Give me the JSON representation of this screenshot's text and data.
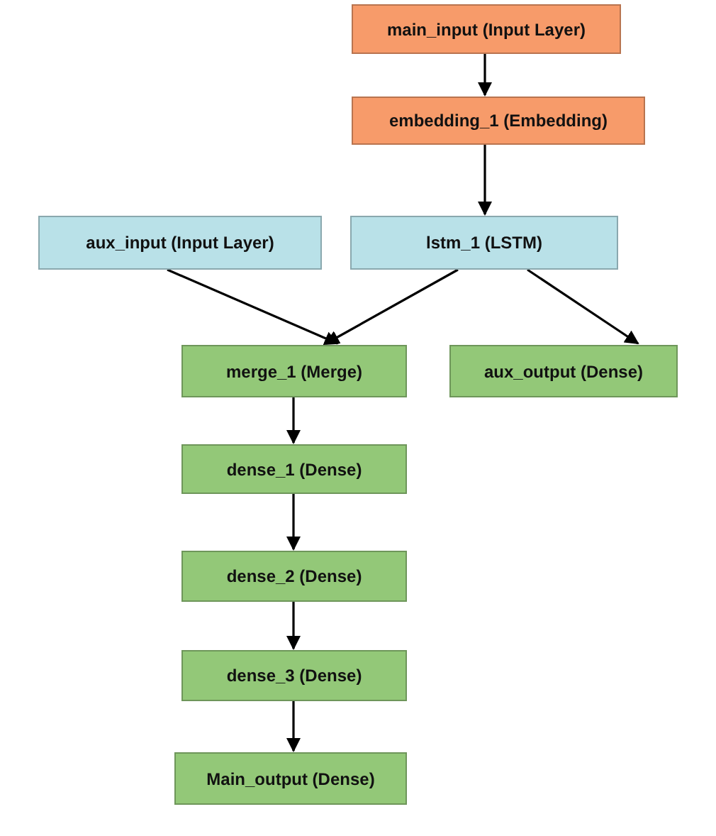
{
  "nodes": [
    {
      "label": "main_input (Input Layer)",
      "color": "#f79b6a"
    },
    {
      "label": "embedding_1 (Embedding)",
      "color": "#f79b6a"
    },
    {
      "label": "aux_input (Input Layer)",
      "color": "#b9e1e8"
    },
    {
      "label": "lstm_1 (LSTM)",
      "color": "#b9e1e8"
    },
    {
      "label": "merge_1 (Merge)",
      "color": "#93c878"
    },
    {
      "label": "aux_output (Dense)",
      "color": "#93c878"
    },
    {
      "label": "dense_1 (Dense)",
      "color": "#93c878"
    },
    {
      "label": "dense_2 (Dense)",
      "color": "#93c878"
    },
    {
      "label": "dense_3 (Dense)",
      "color": "#93c878"
    },
    {
      "label": "Main_output (Dense)",
      "color": "#93c878"
    }
  ]
}
